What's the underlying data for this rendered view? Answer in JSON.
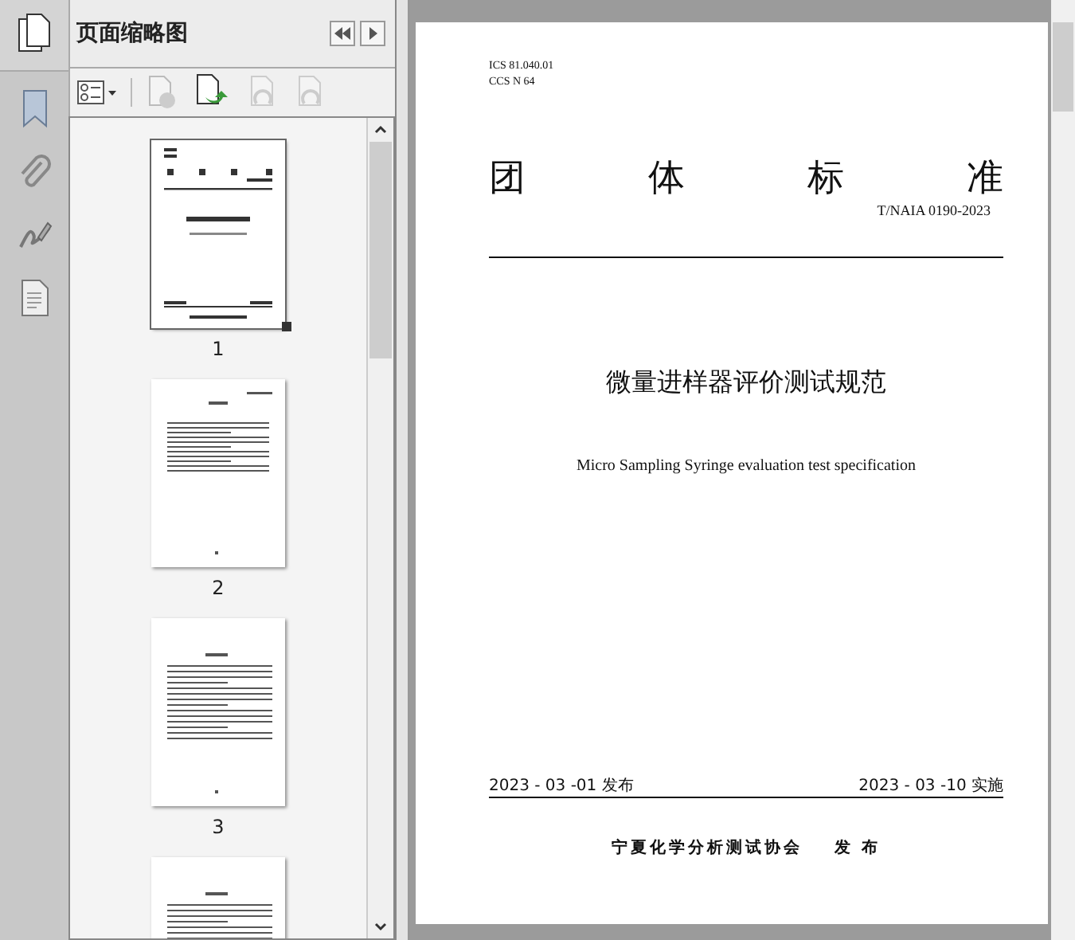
{
  "thumbnail_panel": {
    "title": "页面缩略图",
    "thumbnails": [
      {
        "label": "1",
        "selected": true,
        "kind": "cover"
      },
      {
        "label": "2",
        "selected": false,
        "kind": "toc"
      },
      {
        "label": "3",
        "selected": false,
        "kind": "text"
      },
      {
        "kind": "text",
        "selected": false
      }
    ]
  },
  "document_page": {
    "ics": "ICS  81.040.01",
    "ccs": "CCS N 64",
    "standard_type": [
      "团",
      "体",
      "标",
      "准"
    ],
    "standard_number": "T/NAIA  0190-2023",
    "title_cn": "微量进样器评价测试规范",
    "title_en": "Micro Sampling Syringe evaluation test specification",
    "publish_date": "2023 - 03 -01 发布",
    "effective_date": "2023 - 03 -10 实施",
    "publisher": "宁夏化学分析测试协会",
    "publish_label": "发 布"
  }
}
